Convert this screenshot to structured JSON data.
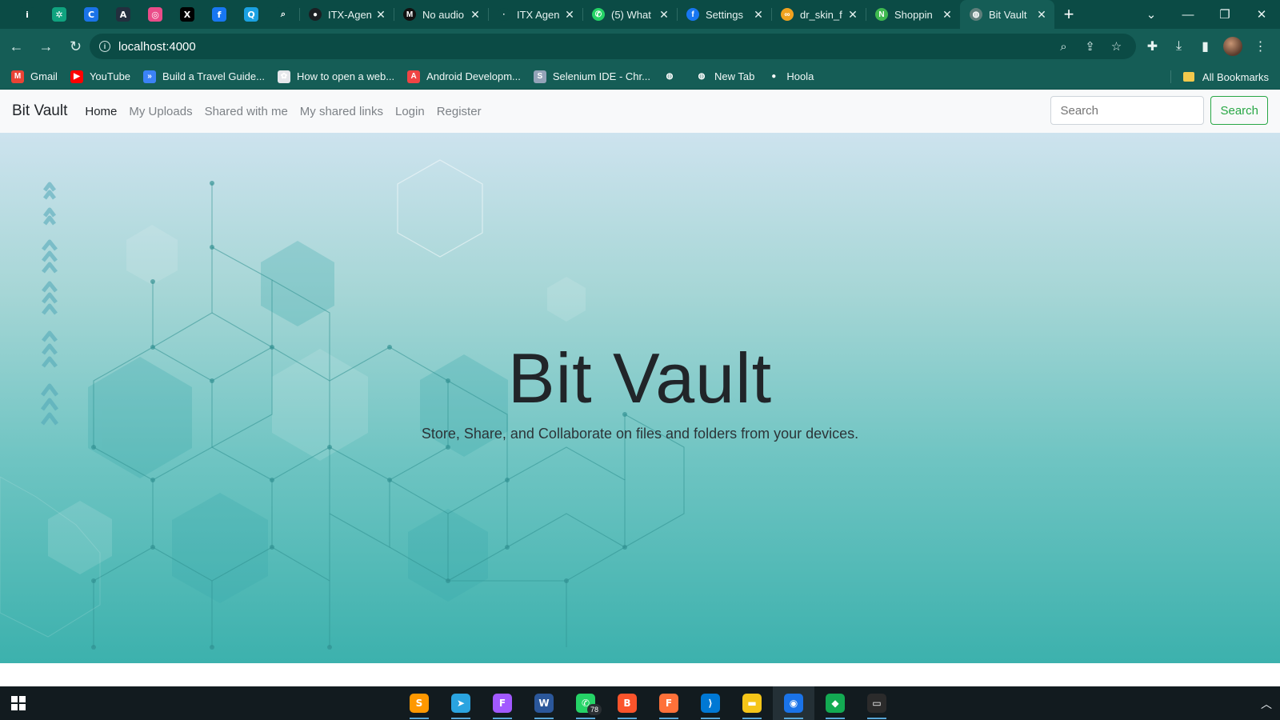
{
  "browser": {
    "pinned_tabs": [
      {
        "icon": "info-icon",
        "color": "#0b4b45"
      },
      {
        "icon": "chatgpt-icon",
        "color": "#10a37f"
      },
      {
        "icon": "canva-icon",
        "color": "#1a73e8"
      },
      {
        "icon": "aws-icon",
        "color": "#232f3e"
      },
      {
        "icon": "dribbble-icon",
        "color": "#ea4c89"
      },
      {
        "icon": "x-twitter-icon",
        "color": "#000000"
      },
      {
        "icon": "facebook-icon",
        "color": "#1877f2"
      },
      {
        "icon": "search-app-icon",
        "color": "#1ba1e2"
      },
      {
        "icon": "search-icon",
        "color": "#0b4b45"
      }
    ],
    "tabs": [
      {
        "label": "ITX-Agen",
        "icon": "github-icon",
        "color": "#1b1f23"
      },
      {
        "label": "No audio",
        "icon": "medium-icon",
        "color": "#111111"
      },
      {
        "label": "ITX Agen",
        "icon": "itx-icon",
        "color": "#0b4b45"
      },
      {
        "label": "(5) What",
        "icon": "whatsapp-icon",
        "color": "#25d366"
      },
      {
        "label": "Settings",
        "icon": "facebook-icon",
        "color": "#1877f2"
      },
      {
        "label": "dr_skin_f",
        "icon": "infinity-icon",
        "color": "#f0a21f"
      },
      {
        "label": "Shoppin",
        "icon": "n-icon",
        "color": "#3fb950"
      },
      {
        "label": "Bit Vault",
        "icon": "globe-icon",
        "color": "#5f7f7b",
        "active": true
      }
    ],
    "url": "localhost:4000"
  },
  "bookmarks": [
    {
      "label": "Gmail",
      "icon": "gmail-icon",
      "color": "#ea4335"
    },
    {
      "label": "YouTube",
      "icon": "youtube-icon",
      "color": "#ff0000"
    },
    {
      "label": "Build a Travel Guide...",
      "icon": "bookmark-app-icon",
      "color": "#3b82f6"
    },
    {
      "label": "How to open a web...",
      "icon": "bookmark-site-icon",
      "color": "#e5e7eb"
    },
    {
      "label": "Android Developm...",
      "icon": "android-icon",
      "color": "#ef4444"
    },
    {
      "label": "Selenium IDE - Chr...",
      "icon": "selenium-icon",
      "color": "#94a3b8"
    },
    {
      "label": "",
      "icon": "globe-icon",
      "color": "#155d56"
    },
    {
      "label": "New Tab",
      "icon": "globe-icon",
      "color": "#155d56"
    },
    {
      "label": "Hoola",
      "icon": "github-icon",
      "color": "#155d56"
    }
  ],
  "all_bookmarks_label": "All Bookmarks",
  "site": {
    "brand": "Bit Vault",
    "nav": [
      "Home",
      "My Uploads",
      "Shared with me",
      "My shared links",
      "Login",
      "Register"
    ],
    "search_placeholder": "Search",
    "search_button": "Search",
    "hero_title": "Bit Vault",
    "hero_subtitle": "Store, Share, and Collaborate on files and folders from your devices."
  },
  "taskbar": {
    "apps": [
      {
        "icon": "sublime-text-icon",
        "color": "#ff9800"
      },
      {
        "icon": "telegram-icon",
        "color": "#2aa4e0"
      },
      {
        "icon": "figma-icon",
        "color": "#a259ff"
      },
      {
        "icon": "word-app-icon",
        "color": "#2b579a"
      },
      {
        "icon": "whatsapp-icon",
        "color": "#25d366",
        "badge": "78"
      },
      {
        "icon": "brave-icon",
        "color": "#fb542b"
      },
      {
        "icon": "firefox-icon",
        "color": "#ff7139"
      },
      {
        "icon": "vscode-icon",
        "color": "#0078d4"
      },
      {
        "icon": "file-explorer-icon",
        "color": "#f5c518"
      },
      {
        "icon": "chrome-icon",
        "color": "#1a73e8",
        "active": true
      },
      {
        "icon": "mongodb-compass-icon",
        "color": "#13aa52"
      },
      {
        "icon": "terminal-icon",
        "color": "#2b2b2b"
      }
    ]
  }
}
